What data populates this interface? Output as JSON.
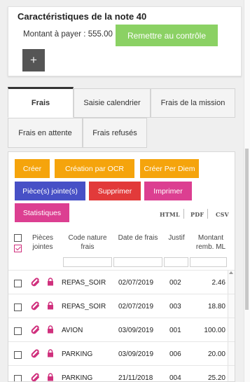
{
  "note_card": {
    "title": "Caractéristiques de la note 40",
    "amount_label": "Montant à payer : 555.00",
    "submit_label": "Remettre au contrôle",
    "add_label": "+"
  },
  "tabs": [
    {
      "label": "Frais",
      "active": true
    },
    {
      "label": "Saisie calendrier",
      "active": false
    },
    {
      "label": "Frais de la mission",
      "active": false
    },
    {
      "label": "Frais en attente",
      "active": false
    },
    {
      "label": "Frais refusés",
      "active": false
    }
  ],
  "actions": {
    "create": "Créer",
    "create_ocr": "Création par OCR",
    "create_per_diem": "Créer Per Diem",
    "attachments": "Pièce(s) jointe(s)",
    "delete": "Supprimer",
    "print": "Imprimer",
    "stats": "Statistiques"
  },
  "exports": [
    "HTML",
    "PDF",
    "CSV"
  ],
  "columns": {
    "attachments": "Pièces jointes",
    "code": "Code nature frais",
    "date": "Date de frais",
    "justif": "Justif",
    "amount": "Montant remb. ML"
  },
  "rows": [
    {
      "code": "REPAS_SOIR",
      "date": "02/07/2019",
      "justif": "002",
      "amount": "2.46"
    },
    {
      "code": "REPAS_SOIR",
      "date": "02/07/2019",
      "justif": "003",
      "amount": "18.80"
    },
    {
      "code": "AVION",
      "date": "03/09/2019",
      "justif": "001",
      "amount": "100.00"
    },
    {
      "code": "PARKING",
      "date": "03/09/2019",
      "justif": "006",
      "amount": "20.00"
    },
    {
      "code": "PARKING",
      "date": "21/11/2018",
      "justif": "004",
      "amount": "25.20"
    }
  ],
  "icons": {
    "attachment": "paperclip-icon",
    "lock": "lock-icon"
  },
  "colors": {
    "submit": "#8bd164",
    "orange": "#f5a40c",
    "blue": "#4750c6",
    "red": "#e23a3a",
    "pink": "#dc3f91",
    "icon_pink": "#d0307d"
  }
}
